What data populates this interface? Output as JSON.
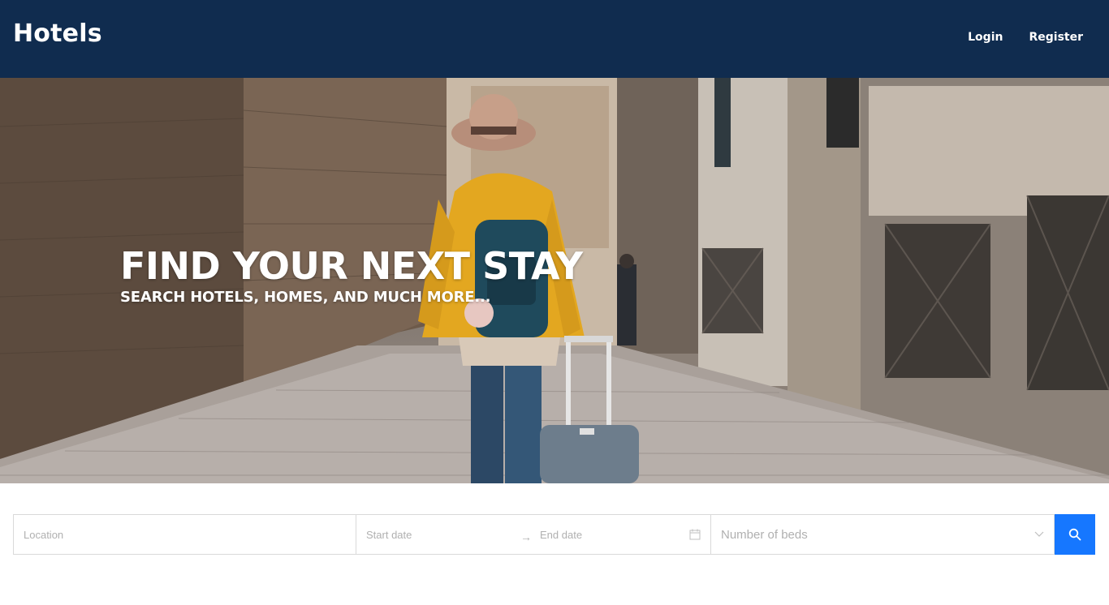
{
  "header": {
    "brand": "Hotels",
    "nav": {
      "login": "Login",
      "register": "Register"
    },
    "background_color": "#102c4f"
  },
  "hero": {
    "title": "FIND YOUR NEXT STAY",
    "subtitle": "SEARCH HOTELS, HOMES, AND MUCH MORE..."
  },
  "search": {
    "location_placeholder": "Location",
    "start_date_placeholder": "Start date",
    "end_date_placeholder": "End date",
    "date_separator_icon": "arrow-right-icon",
    "calendar_icon": "calendar-icon",
    "beds_placeholder": "Number of beds",
    "beds_icon": "chevron-down-icon",
    "search_icon": "search-icon",
    "button_color": "#1677ff"
  }
}
